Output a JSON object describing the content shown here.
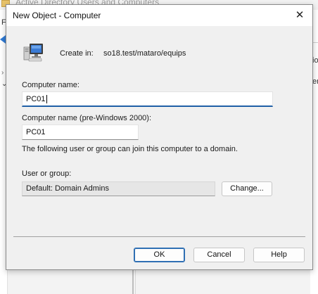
{
  "background": {
    "window_title": "Active Directory Users and Computers",
    "menu_letter": "F",
    "right_text_1": "io",
    "right_text_2": "en"
  },
  "dialog": {
    "title": "New Object - Computer",
    "close_glyph": "✕",
    "create_in_label": "Create in:",
    "create_in_path": "so18.test/mataro/equips",
    "computer_name_label": "Computer name:",
    "computer_name_value": "PC01",
    "pre2000_label": "Computer name (pre-Windows 2000):",
    "pre2000_value": "PC01",
    "join_info": "The following user or group can join this computer to a domain.",
    "user_group_label": "User or group:",
    "user_group_value": "Default: Domain Admins",
    "change_button": "Change...",
    "ok_button": "OK",
    "cancel_button": "Cancel",
    "help_button": "Help"
  },
  "icons": [
    "computer-icon",
    "close-icon",
    "folder-icon",
    "back-arrow-icon"
  ],
  "colors": {
    "accent": "#1f5fa6",
    "default_button_border": "#2f6fb3",
    "dialog_bg": "#f0f0f0"
  }
}
